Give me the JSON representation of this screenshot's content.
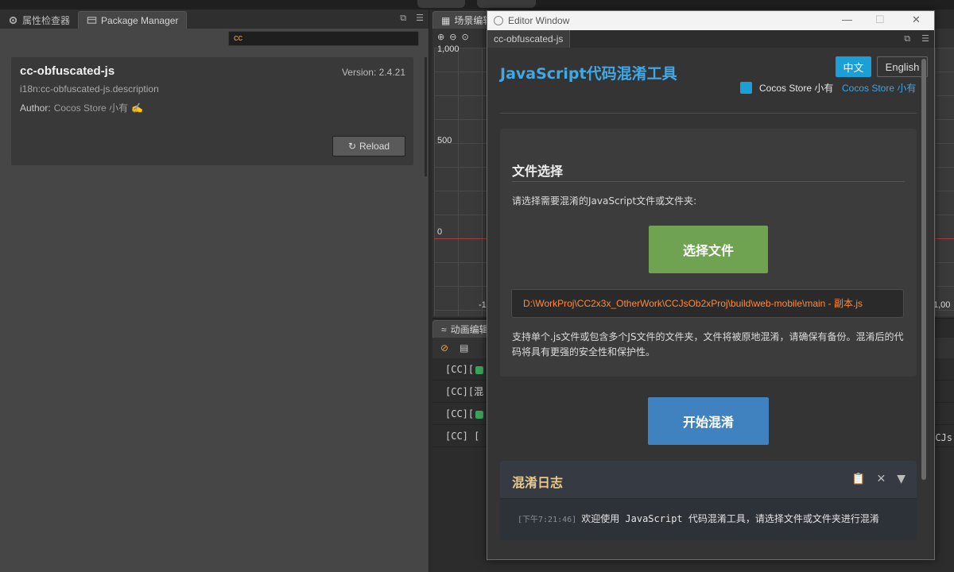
{
  "left_panel": {
    "tabs": [
      {
        "label": "属性检查器"
      },
      {
        "label": "Package Manager"
      }
    ],
    "search": {
      "value": "cc"
    },
    "package": {
      "name": "cc-obfuscated-js",
      "version_label": "Version: 2.4.21",
      "description": "i18n:cc-obfuscated-js.description",
      "author_label": "Author:",
      "author_value": "Cocos Store 小有",
      "reload_label": "Reload"
    }
  },
  "scene_panel": {
    "tab_label": "场景编辑",
    "y_labels": [
      "1,000",
      "500",
      "0"
    ],
    "x_labels": [
      "-1",
      "1,00"
    ]
  },
  "console_panel": {
    "tab_label": "动画编辑",
    "lines": [
      "[CC][",
      "[CC][混",
      "[CC][",
      "[CC] ["
    ],
    "right_fragment": "CCJs"
  },
  "editor_window": {
    "title": "Editor Window",
    "tab_label": "cc-obfuscated-js",
    "tool_title": "JavaScript代码混淆工具",
    "lang_zh": "中文",
    "lang_en": "English",
    "store_label": "Cocos Store 小有",
    "store_link": "Cocos Store 小有",
    "file_section": {
      "title": "文件选择",
      "prompt": "请选择需要混淆的JavaScript文件或文件夹:",
      "select_button": "选择文件",
      "file_path": "D:\\WorkProj\\CC2x3x_OtherWork\\CCJsOb2xProj\\build\\web-mobile\\main - 副本.js",
      "note": "支持单个.js文件或包含多个JS文件的文件夹，文件将被原地混淆，请确保有备份。混淆后的代码将具有更强的安全性和保护性。"
    },
    "start_button": "开始混淆",
    "log": {
      "title": "混淆日志",
      "entries": [
        {
          "time": "[下午7:21:46]",
          "message": "欢迎使用 JavaScript 代码混淆工具，请选择文件或文件夹进行混淆"
        }
      ]
    }
  }
}
